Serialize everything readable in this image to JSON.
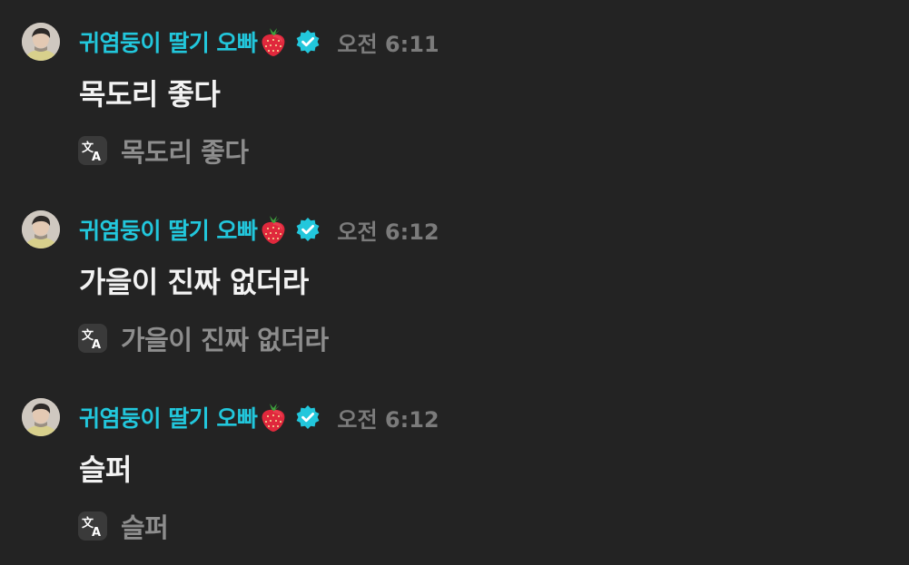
{
  "messages": [
    {
      "username": "귀염둥이 딸기 오빠",
      "name_emoji": "strawberry-icon",
      "verified_badge": "verified-check-icon",
      "time": "오전 6:11",
      "text": "목도리 좋다",
      "translation_icon": "translate-icon",
      "translation": "목도리 좋다"
    },
    {
      "username": "귀염둥이 딸기 오빠",
      "name_emoji": "strawberry-icon",
      "verified_badge": "verified-check-icon",
      "time": "오전 6:12",
      "text": "가을이 진짜 없더라",
      "translation_icon": "translate-icon",
      "translation": "가을이 진짜 없더라"
    },
    {
      "username": "귀염둥이 딸기 오빠",
      "name_emoji": "strawberry-icon",
      "verified_badge": "verified-check-icon",
      "time": "오전 6:12",
      "text": "슬퍼",
      "translation_icon": "translate-icon",
      "translation": "슬퍼"
    }
  ],
  "colors": {
    "background": "#232323",
    "username": "#22c7dc",
    "timestamp": "#7b7b7b",
    "message_text": "#f2f2f2",
    "translation_text": "#8d8d8d",
    "verified_badge": "#22c7dc"
  }
}
